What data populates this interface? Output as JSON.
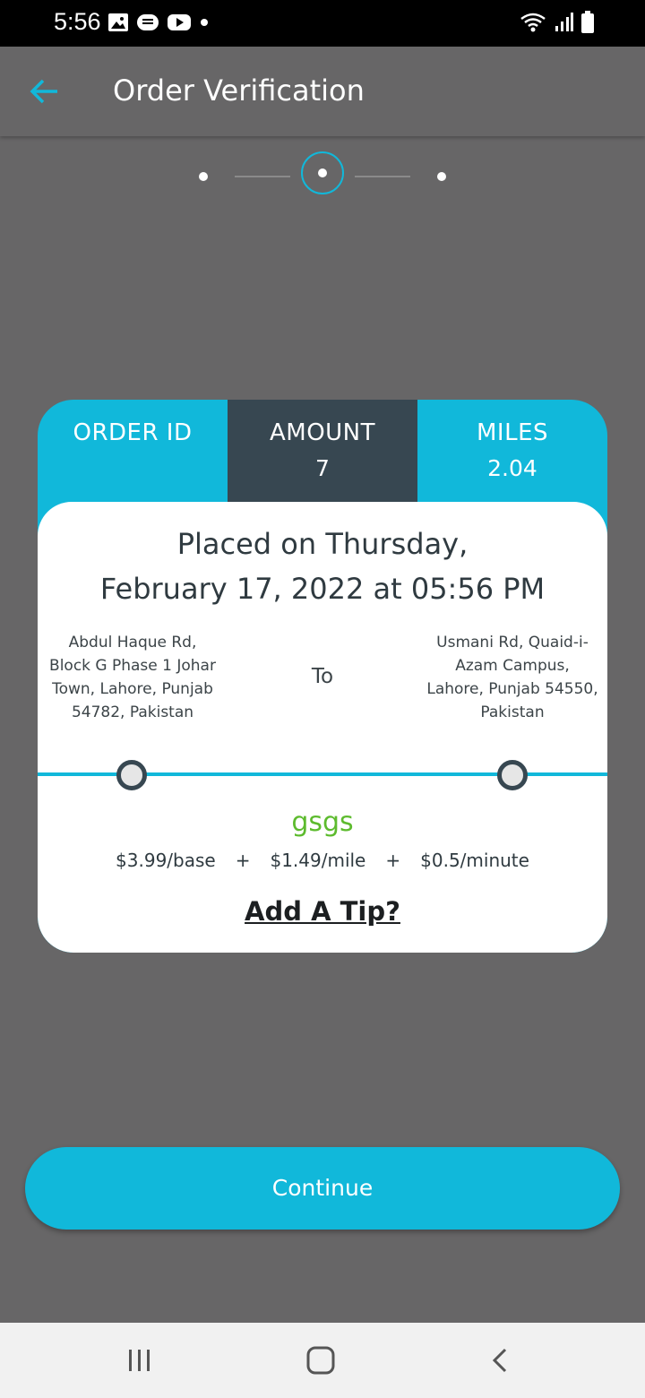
{
  "status_bar": {
    "time": "5:56",
    "left_icons": [
      "image-icon",
      "message-icon",
      "youtube-icon",
      "dot-icon"
    ],
    "right_icons": [
      "wifi-icon",
      "signal-icon",
      "battery-icon"
    ]
  },
  "header": {
    "title": "Order Verification",
    "back_icon": "arrow-left-icon"
  },
  "stepper": {
    "steps": 3,
    "current": 2
  },
  "order_card": {
    "order_id_label": "ORDER ID",
    "order_id_value": "",
    "amount_label": "AMOUNT",
    "amount_value": "7",
    "miles_label": "MILES",
    "miles_value": "2.04",
    "placed_line1": "Placed on Thursday,",
    "placed_line2": "February 17, 2022 at 05:56 PM",
    "from_address": "Abdul Haque Rd, Block G Phase 1 Johar Town, Lahore, Punjab 54782, Pakistan",
    "to_label": "To",
    "to_address": "Usmani Rd, Quaid-i-Azam Campus, Lahore, Punjab 54550, Pakistan",
    "service_name": "gsgs",
    "price_base": "$3.99/base",
    "plus": "+",
    "price_mile": "$1.49/mile",
    "price_minute": "$0.5/minute",
    "tip_label": "Add A Tip?"
  },
  "actions": {
    "continue_label": "Continue"
  },
  "nav": {
    "recents_icon": "recents-icon",
    "home_icon": "home-icon",
    "back_icon": "back-chevron-icon"
  },
  "colors": {
    "accent": "#11b8da",
    "dark": "#374751",
    "background": "#676667",
    "service_green": "#5dbb2e"
  }
}
